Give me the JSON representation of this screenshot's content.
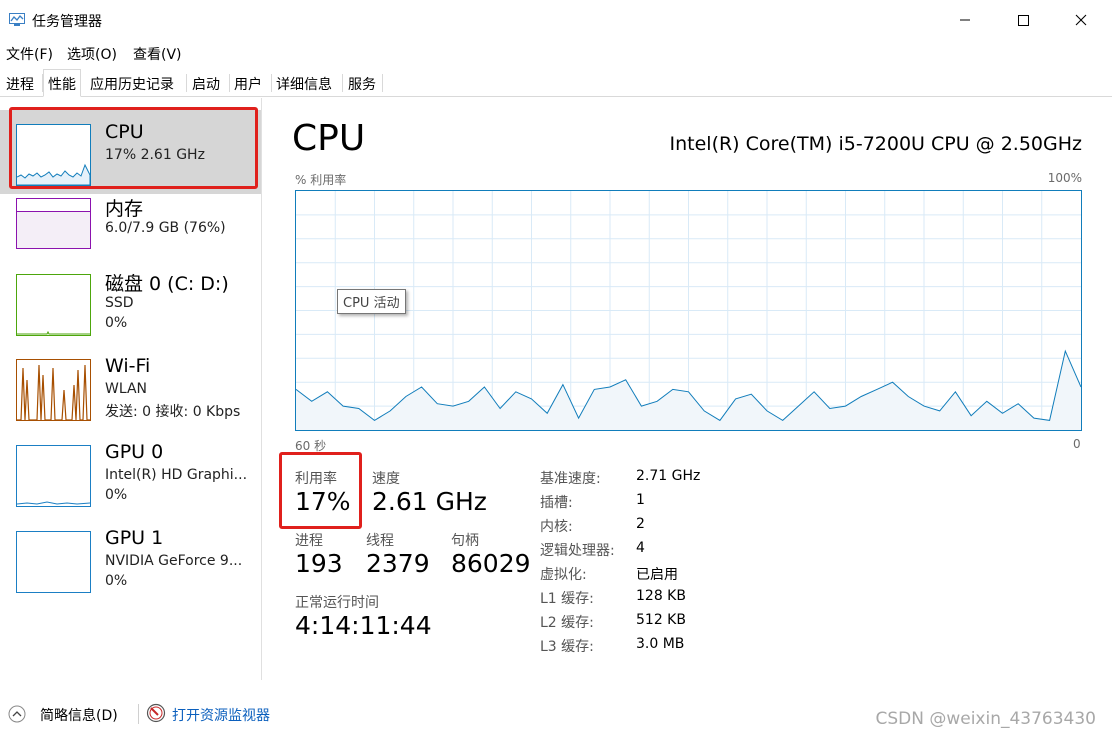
{
  "window": {
    "title": "任务管理器"
  },
  "menu": [
    "文件(F)",
    "选项(O)",
    "查看(V)"
  ],
  "tabs": [
    "进程",
    "性能",
    "应用历史记录",
    "启动",
    "用户",
    "详细信息",
    "服务"
  ],
  "sidebar": {
    "items": [
      {
        "name": "CPU",
        "line1": "17% 2.61 GHz",
        "line2": ""
      },
      {
        "name": "内存",
        "line1": "6.0/7.9 GB (76%)",
        "line2": ""
      },
      {
        "name": "磁盘 0 (C: D:)",
        "line1": "SSD",
        "line2": "0%"
      },
      {
        "name": "Wi-Fi",
        "line1": "WLAN",
        "line2": "发送: 0 接收: 0 Kbps"
      },
      {
        "name": "GPU 0",
        "line1": "Intel(R) HD Graphi...",
        "line2": "0%"
      },
      {
        "name": "GPU 1",
        "line1": "NVIDIA GeForce 9...",
        "line2": "0%"
      }
    ]
  },
  "main": {
    "title": "CPU",
    "model": "Intel(R) Core(TM) i5-7200U CPU @ 2.50GHz",
    "y_label": "% 利用率",
    "y_max": "100%",
    "x_left": "60 秒",
    "x_right": "0",
    "tooltip": "CPU 活动",
    "utilization_label": "利用率",
    "utilization": "17%",
    "speed_label": "速度",
    "speed": "2.61 GHz",
    "processes_label": "进程",
    "processes": "193",
    "threads_label": "线程",
    "threads": "2379",
    "handles_label": "句柄",
    "handles": "86029",
    "uptime_label": "正常运行时间",
    "uptime": "4:14:11:44",
    "info": [
      {
        "label": "基准速度:",
        "value": "2.71 GHz"
      },
      {
        "label": "插槽:",
        "value": "1"
      },
      {
        "label": "内核:",
        "value": "2"
      },
      {
        "label": "逻辑处理器:",
        "value": "4"
      },
      {
        "label": "虚拟化:",
        "value": "已启用"
      },
      {
        "label": "L1 缓存:",
        "value": "128 KB"
      },
      {
        "label": "L2 缓存:",
        "value": "512 KB"
      },
      {
        "label": "L3 缓存:",
        "value": "3.0 MB"
      }
    ]
  },
  "cpu_history": [
    17,
    12,
    16,
    10,
    9,
    4,
    8,
    14,
    18,
    11,
    10,
    12,
    18,
    9,
    16,
    13,
    7,
    19,
    5,
    17,
    18,
    21,
    10,
    12,
    17,
    16,
    8,
    4,
    13,
    15,
    8,
    4,
    10,
    16,
    9,
    10,
    14,
    17,
    20,
    14,
    10,
    8,
    16,
    6,
    12,
    7,
    11,
    5,
    4,
    33,
    18
  ],
  "footer": {
    "brief": "简略信息(D)",
    "monitor": "打开资源监视器"
  },
  "watermark": "CSDN @weixin_43763430",
  "colors": {
    "cpu": "#117dbb",
    "memory": "#8b12ae",
    "disk": "#4da60c",
    "wifi": "#a74f01",
    "gpu": "#1b7fc4",
    "highlight": "#e0201c"
  }
}
